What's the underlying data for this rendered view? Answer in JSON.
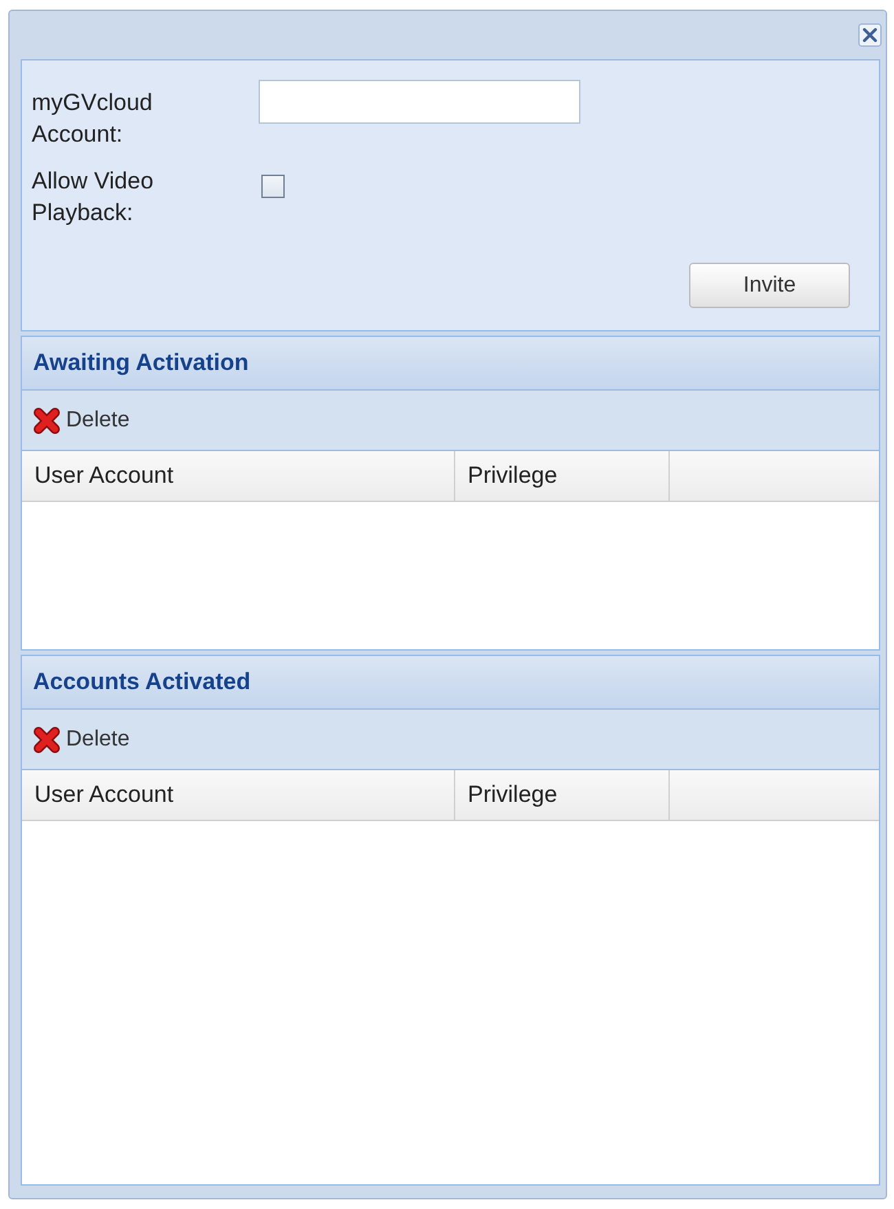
{
  "form": {
    "account": {
      "label": "myGVcloud Account:"
    },
    "video_playback": {
      "label": "Allow Video Playback:",
      "checked": false
    },
    "invite_button": "Invite"
  },
  "sections": [
    {
      "title": "Awaiting Activation",
      "toolbar": [
        {
          "label": "Delete"
        }
      ],
      "columns": [
        "User Account",
        "Privilege"
      ]
    },
    {
      "title": "Accounts Activated",
      "toolbar": [
        {
          "label": "Delete"
        }
      ],
      "columns": [
        "User Account",
        "Privilege"
      ]
    }
  ]
}
